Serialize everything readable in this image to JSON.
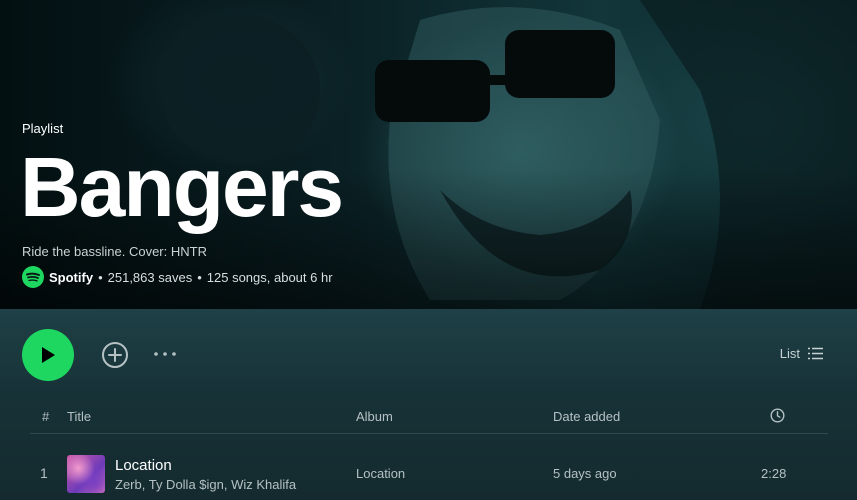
{
  "hero": {
    "type_label": "Playlist",
    "title": "Bangers",
    "description": "Ride the bassline. Cover: HNTR",
    "owner": "Spotify",
    "saves": "251,863 saves",
    "stats": "125 songs, about 6 hr",
    "separator": "•",
    "owner_icon": "spotify-logo-icon"
  },
  "actions": {
    "play_icon": "play-icon",
    "add_icon": "add-circle-icon",
    "more_icon": "more-options-icon",
    "view_label": "List",
    "view_icon": "list-view-icon"
  },
  "table": {
    "headers": {
      "index": "#",
      "title": "Title",
      "album": "Album",
      "date_added": "Date added",
      "duration_icon": "clock-icon"
    },
    "rows": [
      {
        "index": "1",
        "title": "Location",
        "artists": "Zerb, Ty Dolla $ign, Wiz Khalifa",
        "album": "Location",
        "date_added": "5 days ago",
        "duration": "2:28"
      }
    ]
  },
  "colors": {
    "accent": "#1ed760",
    "background": "#121212",
    "header_teal": "#1e4046"
  }
}
